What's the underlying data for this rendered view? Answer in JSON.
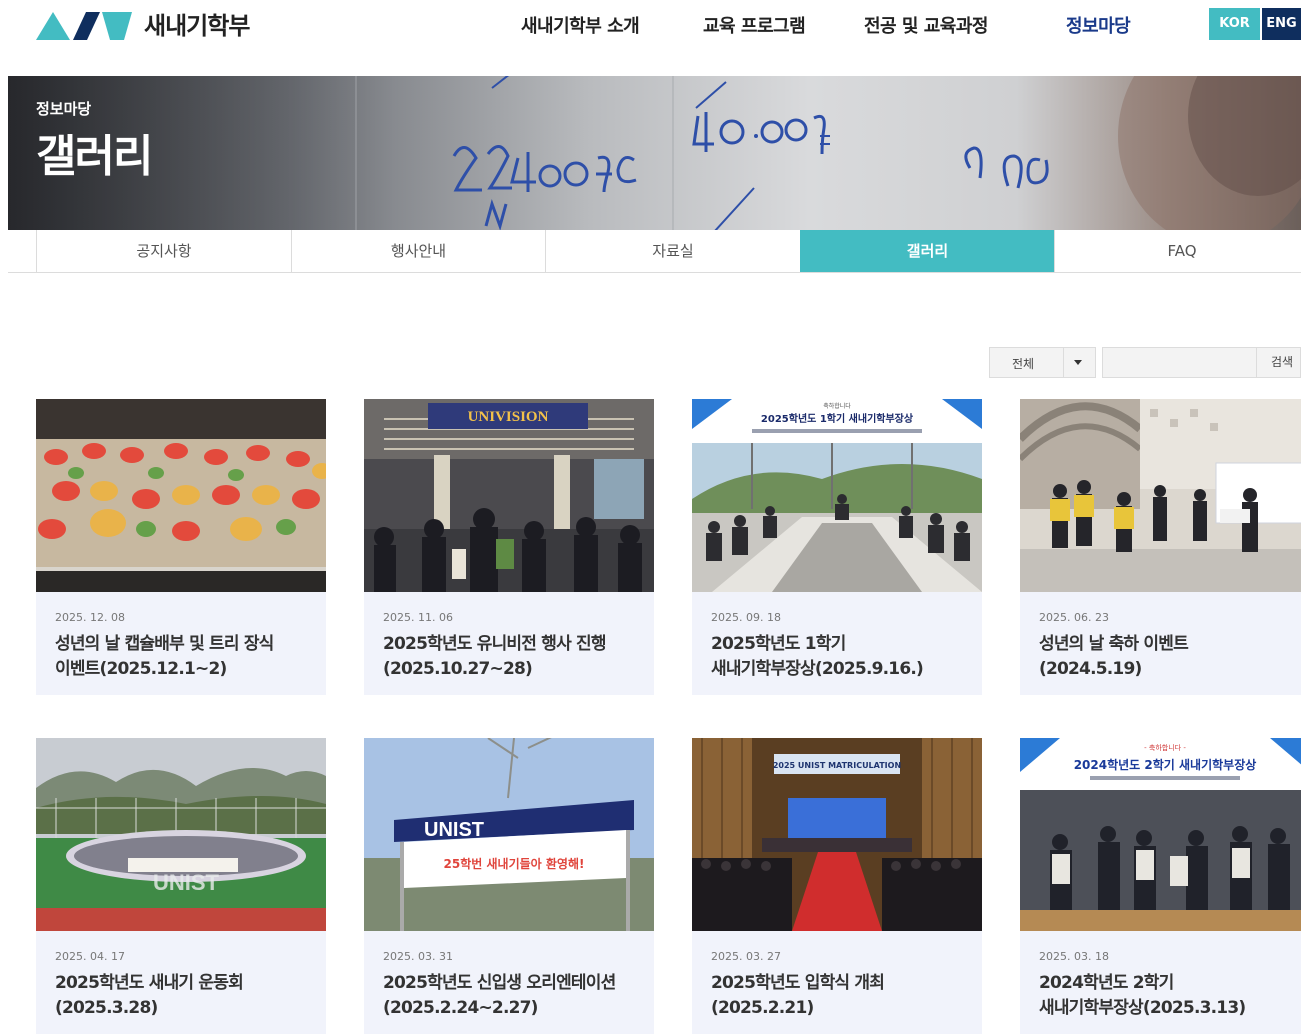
{
  "header": {
    "logo_text": "새내기학부",
    "nav": [
      "새내기학부 소개",
      "교육 프로그램",
      "전공 및 교육과정",
      "정보마당"
    ],
    "lang": {
      "kor": "KOR",
      "eng": "ENG"
    }
  },
  "banner": {
    "subtitle": "정보마당",
    "title": "갤러리"
  },
  "tabs": [
    "공지사항",
    "행사안내",
    "자료실",
    "갤러리",
    "FAQ"
  ],
  "search": {
    "select_value": "전체",
    "input_value": "",
    "button_label": "검색"
  },
  "gallery": [
    {
      "date": "2025. 12. 08",
      "title_lines": [
        "성년의 날 캡슐배부 및 트리 장식",
        "이벤트(2025.12.1~2)"
      ]
    },
    {
      "date": "2025. 11. 06",
      "title_lines": [
        "2025학년도 유니비전 행사 진행",
        "(2025.10.27~28)"
      ]
    },
    {
      "date": "2025. 09. 18",
      "title_lines": [
        "2025학년도 1학기",
        "새내기학부장상(2025.9.16.)"
      ]
    },
    {
      "date": "2025. 06. 23",
      "title_lines": [
        "성년의 날 축하 이벤트",
        "(2024.5.19)"
      ]
    },
    {
      "date": "2025. 04. 17",
      "title_lines": [
        "2025학년도 새내기 운동회",
        "(2025.3.28)"
      ]
    },
    {
      "date": "2025. 03. 31",
      "title_lines": [
        "2025학년도 신입생 오리엔테이션",
        "(2025.2.24~2.27)"
      ]
    },
    {
      "date": "2025. 03. 27",
      "title_lines": [
        "2025학년도 입학식 개최",
        "(2025.2.21)"
      ]
    },
    {
      "date": "2025. 03. 18",
      "title_lines": [
        "2024학년도 2학기",
        "새내기학부장상(2025.3.13)"
      ]
    }
  ],
  "photo_text": {
    "p2_sign": "UNIVISION",
    "p3_top": "축하합니다",
    "p3_heading": "2025학년도 1학기  새내기학부장상",
    "p5_sign": "UNIST",
    "p6_logo": "UNIST",
    "p6_banner": "25학번 새내기들아 환영해!",
    "p7_screen": "2025 UNIST MATRICULATION",
    "p8_top": "- 축하합니다 -",
    "p8_heading": "2024학년도 2학기 새내기학부장상"
  },
  "colors": {
    "accent": "#43bcc2",
    "navy": "#0f2e5e",
    "card_bg": "#f1f3fb"
  }
}
